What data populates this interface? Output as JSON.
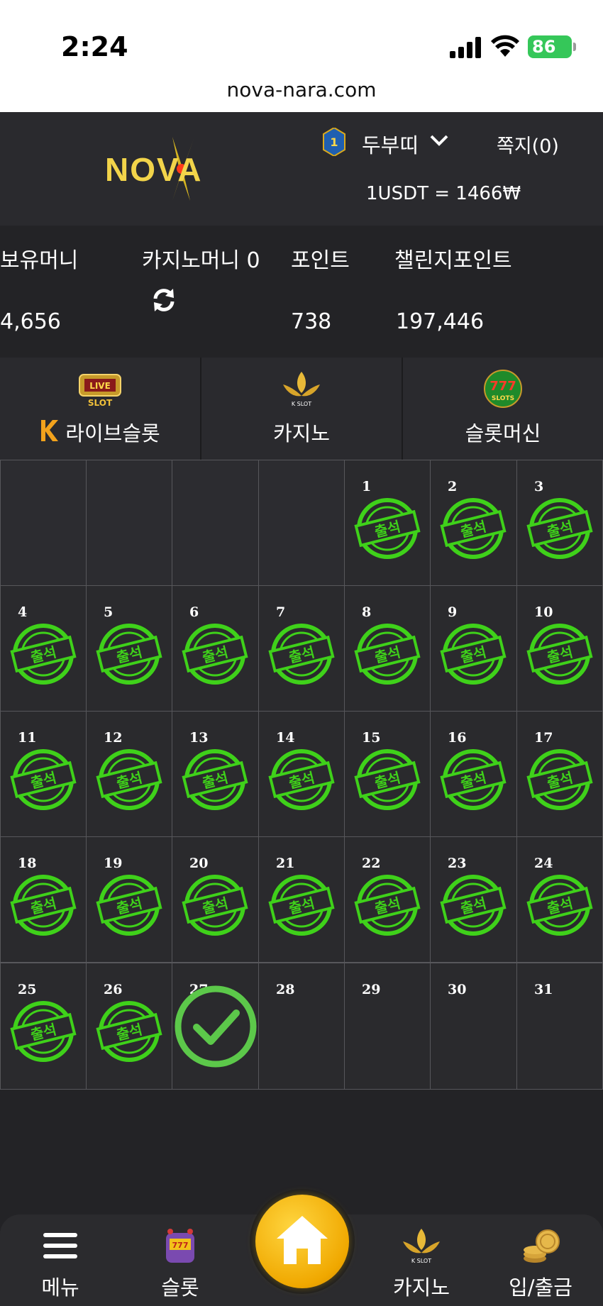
{
  "status": {
    "time": "2:24",
    "battery": "86"
  },
  "browser": {
    "url": "nova-nara.com"
  },
  "header": {
    "logo": "NOVA",
    "rank": "1",
    "username": "두부띠",
    "messages": "쪽지(0)",
    "rate": "1USDT = 1466₩"
  },
  "balances": {
    "money_label": "보유머니",
    "money_value": "4,656",
    "casino_label": "카지노머니 0",
    "point_label": "포인트",
    "point_value": "738",
    "challenge_label": "챌린지포인트",
    "challenge_value": "197,446"
  },
  "categories": [
    {
      "label": "라이브슬롯",
      "icon": "live-slot-icon"
    },
    {
      "label": "카지노",
      "icon": "k-slot-lotus-icon"
    },
    {
      "label": "슬롯머신",
      "icon": "777-slots-icon"
    }
  ],
  "calendar": {
    "stamp_text": "출석",
    "days": [
      {
        "n": "1",
        "attended": true
      },
      {
        "n": "2",
        "attended": true
      },
      {
        "n": "3",
        "attended": true
      },
      {
        "n": "4",
        "attended": true
      },
      {
        "n": "5",
        "attended": true
      },
      {
        "n": "6",
        "attended": true
      },
      {
        "n": "7",
        "attended": true
      },
      {
        "n": "8",
        "attended": true
      },
      {
        "n": "9",
        "attended": true
      },
      {
        "n": "10",
        "attended": true
      },
      {
        "n": "11",
        "attended": true
      },
      {
        "n": "12",
        "attended": true
      },
      {
        "n": "13",
        "attended": true
      },
      {
        "n": "14",
        "attended": true
      },
      {
        "n": "15",
        "attended": true
      },
      {
        "n": "16",
        "attended": true
      },
      {
        "n": "17",
        "attended": true
      },
      {
        "n": "18",
        "attended": true
      },
      {
        "n": "19",
        "attended": true
      },
      {
        "n": "20",
        "attended": true
      },
      {
        "n": "21",
        "attended": true
      },
      {
        "n": "22",
        "attended": true
      },
      {
        "n": "23",
        "attended": true
      },
      {
        "n": "24",
        "attended": true
      },
      {
        "n": "25",
        "attended": true
      },
      {
        "n": "26",
        "attended": true
      },
      {
        "n": "27",
        "attended": false,
        "today": true
      },
      {
        "n": "28",
        "attended": false
      },
      {
        "n": "29",
        "attended": false
      },
      {
        "n": "30",
        "attended": false
      },
      {
        "n": "31",
        "attended": false
      }
    ]
  },
  "nav": {
    "menu": "메뉴",
    "slot": "슬롯",
    "casino": "카지노",
    "bank": "입/출금"
  },
  "colors": {
    "stamp_green": "#3fd11a",
    "accent_gold": "#f2c21a",
    "check_green": "#5cc84a"
  }
}
